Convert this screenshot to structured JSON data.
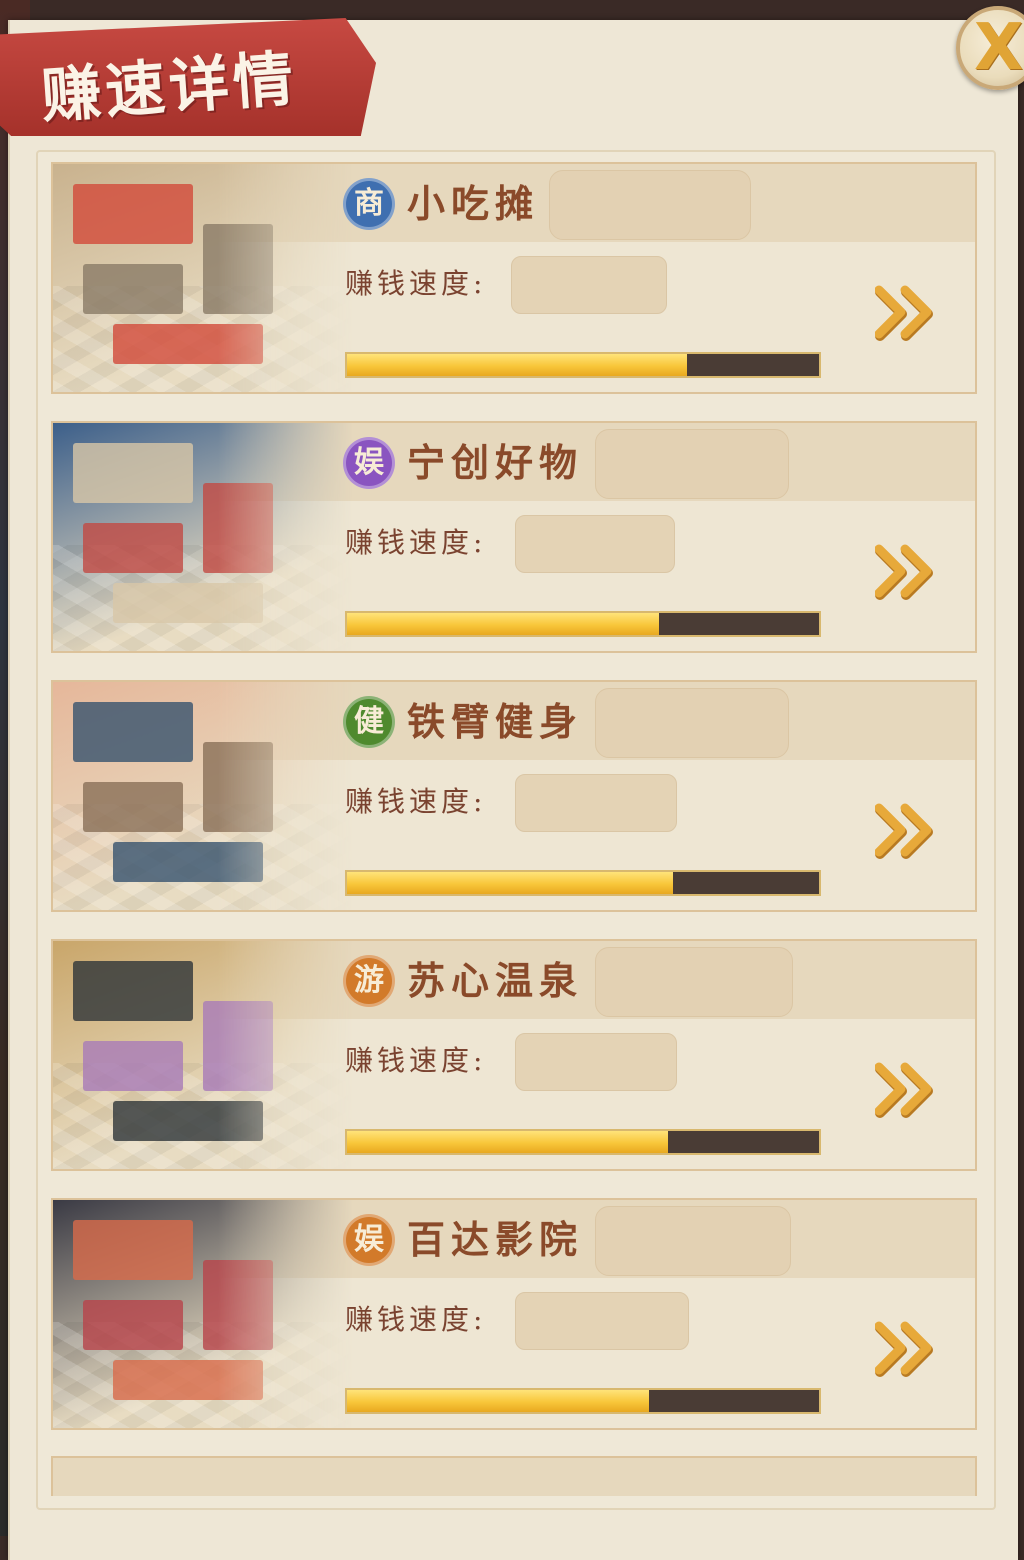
{
  "title": "赚速详情",
  "close_label": "X",
  "colors": {
    "banner": "#c23a32",
    "progress_fill": "#f8c63a",
    "progress_track": "#4a3c35",
    "arrow": "#e7a93a"
  },
  "rate_label": "赚钱速度:",
  "shops": [
    {
      "badge": "商",
      "badge_color": "#3f6fb0",
      "name": "小吃摊",
      "progress": 0.72,
      "name_box_w": 200,
      "rate_box_w": 154,
      "art": [
        "#d24a3a",
        "#c9b28e",
        "#8a7a66"
      ]
    },
    {
      "badge": "娱",
      "badge_color": "#8a54c0",
      "name": "宁创好物",
      "progress": 0.66,
      "name_box_w": 192,
      "rate_box_w": 158,
      "art": [
        "#d8c7a8",
        "#3c5f8a",
        "#c24a44"
      ]
    },
    {
      "badge": "健",
      "badge_color": "#4f8a2e",
      "name": "铁臂健身",
      "progress": 0.69,
      "name_box_w": 192,
      "rate_box_w": 160,
      "art": [
        "#37526e",
        "#e6b79a",
        "#8a6f58"
      ]
    },
    {
      "badge": "游",
      "badge_color": "#d27a2a",
      "name": "苏心温泉",
      "progress": 0.68,
      "name_box_w": 196,
      "rate_box_w": 160,
      "art": [
        "#2e3438",
        "#c9a66a",
        "#a77ab8"
      ]
    },
    {
      "badge": "娱",
      "badge_color": "#d27a2a",
      "name": "百达影院",
      "progress": 0.64,
      "name_box_w": 194,
      "rate_box_w": 172,
      "art": [
        "#d86a4a",
        "#3a3a44",
        "#b8434a"
      ]
    }
  ]
}
